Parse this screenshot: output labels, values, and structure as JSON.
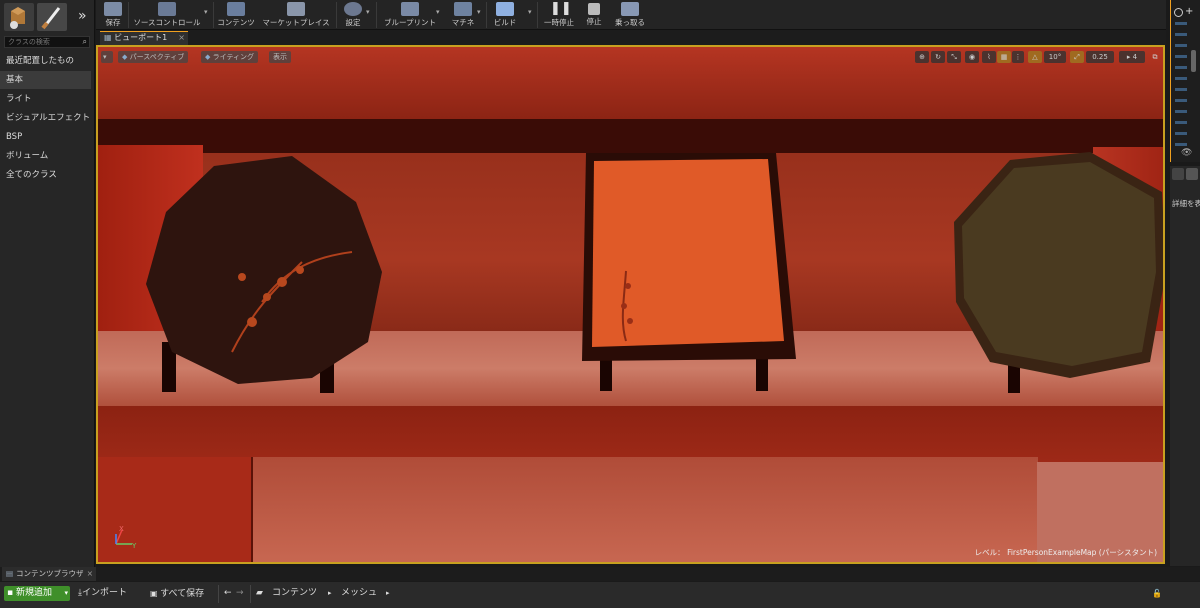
{
  "modes": {
    "search_placeholder": "クラスの検索",
    "categories": [
      "最近配置したもの",
      "基本",
      "ライト",
      "ビジュアルエフェクト",
      "BSP",
      "ボリューム",
      "全てのクラス"
    ],
    "selected": "基本"
  },
  "toolbar": {
    "save": "保存",
    "source_control": "ソースコントロール",
    "content": "コンテンツ",
    "marketplace": "マーケットプレイス",
    "settings": "設定",
    "blueprint": "ブループリント",
    "matinee": "マチネ",
    "build": "ビルド",
    "pause": "一時停止",
    "stop": "停止",
    "possess": "乗っ取る"
  },
  "viewport": {
    "tab_label": "ビューポート1",
    "perspective": "パースペクティブ",
    "lighting": "ライティング",
    "show": "表示",
    "grid_angle": "10°",
    "scale": "0.25",
    "camera_speed": "4",
    "level_label": "レベル：",
    "level_name": "FirstPersonExampleMap (パーシスタント)",
    "axis_x": "X",
    "axis_y": "Y"
  },
  "details": {
    "label": "詳細を表"
  },
  "content_browser": {
    "tab_label": "コンテンツブラウザ",
    "add_new": "新規追加",
    "import": "インポート",
    "save_all": "すべて保存",
    "path": [
      "コンテンツ",
      "メッシュ"
    ]
  },
  "colors": {
    "accent": "#f0a020",
    "add_new_green": "#3f8f2a"
  }
}
